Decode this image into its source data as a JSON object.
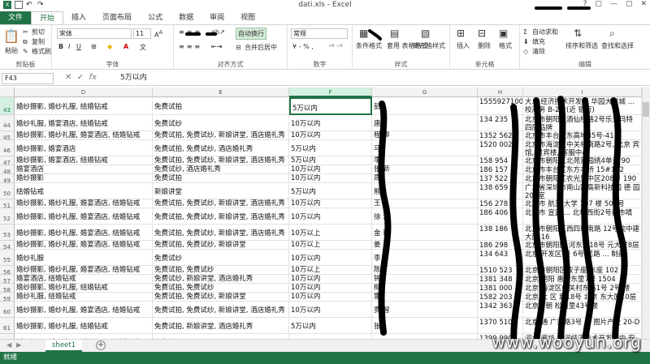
{
  "window": {
    "title": "dati.xls - Excel",
    "buttons": [
      "?",
      "▢",
      "—",
      "▢",
      "✕"
    ]
  },
  "tabs": [
    "文件",
    "开始",
    "插入",
    "页面布局",
    "公式",
    "数据",
    "审阅",
    "视图"
  ],
  "ribbon": {
    "clipboard": {
      "paste": "粘贴",
      "cut": "剪切",
      "copy": "复制",
      "format_painter": "格式刷",
      "label": "剪贴板"
    },
    "font": {
      "name": "宋体",
      "size": "11",
      "label": "字体"
    },
    "alignment": {
      "wrap": "自动换行",
      "merge": "合并后居中",
      "label": "对齐方式"
    },
    "number": {
      "format": "常规",
      "label": "数字"
    },
    "styles": {
      "conditional": "条件格式",
      "table": "套用\n表格格式",
      "cell": "单元格样式",
      "label": "样式"
    },
    "cells": {
      "insert": "插入",
      "delete": "删除",
      "format": "格式",
      "label": "单元格"
    },
    "editing": {
      "autosum": "自动求和",
      "fill": "填充",
      "clear": "清除",
      "sort": "排序和筛选",
      "find": "查找和选择",
      "label": "编辑"
    }
  },
  "formula_bar": {
    "name_box": "F43",
    "fx": "fx",
    "content": "5万以内"
  },
  "columns": [
    "D",
    "E",
    "F",
    "G",
    "H",
    "I"
  ],
  "rows": [
    {
      "num": "43",
      "D": "婚纱摄影, 婚纱礼服, 结婚钻戒",
      "E": "免费试拍",
      "F": "5万以内",
      "G": "彭",
      "H": "15559271001",
      "I": "大... 经济技术开发区 华园大雄城 ... 校商务 B-2号(近 银行)"
    },
    {
      "num": "44",
      "D": "婚纱礼服, 婚宴酒店, 结婚钻戒",
      "E": "免费试纱",
      "F": "10万以内",
      "G": "唐",
      "H": "134 235",
      "I": "北京市朝阳区酒仙桥路2号乐天玛特 四层品牌"
    },
    {
      "num": "45",
      "D": "婚纱摄影, 婚纱礼服, 婚宴酒店, 结婚钻戒",
      "E": "免费试拍, 免费试纱, 新娘讲堂, 酒店婚礼秀",
      "F": "10万以内",
      "G": "程 烨",
      "H": "1352 562",
      "I": "北京市丰台区东高地35号-41"
    },
    {
      "num": "46",
      "D": "婚纱摄影, 婚宴酒店",
      "E": "免费试拍, 免费试纱, 酒店婚礼秀",
      "F": "5万以内",
      "G": "马",
      "H": "1520 002",
      "I": "北京市海淀区中关村南路2号, 北京 宾馆, 贵宾楼, 客服中心"
    },
    {
      "num": "47",
      "D": "婚纱摄影, 婚宴酒店, 结婚钻戒",
      "E": "免费试拍, 免费试纱, 新娘讲堂, 酒店婚礼秀",
      "F": "5万以内",
      "G": "李",
      "H": "158 954",
      "I": "北京市朝阳区北苑家园绣4单元 90"
    },
    {
      "num": "48",
      "D": "婚宴酒店",
      "E": "免费试纱, 酒店婚礼秀",
      "F": "10万以内",
      "G": "张 新",
      "H": "186 157",
      "I": "北京市丰台区东方丰桥 15#102"
    },
    {
      "num": "49",
      "D": "婚纱摄影",
      "E": "免费试拍",
      "F": "10万以内",
      "G": "周",
      "H": "137 522",
      "I": "北京市朝阳区农光里中区208号 190"
    },
    {
      "num": "50",
      "D": "结婚钻戒",
      "E": "新娘讲堂",
      "F": "5万以内",
      "G": "熊",
      "H": "138 659",
      "I": "广东省深圳市南山区高新科技园 德 园 203室"
    },
    {
      "num": "51",
      "D": "婚纱摄影, 婚纱礼服, 婚宴酒店, 结婚钻戒",
      "E": "免费试拍, 免费试纱, 新娘讲堂, 酒店婚礼秀",
      "F": "10万以内",
      "G": "王",
      "H": "156 278",
      "I": "北京市 航天 大学 107 楼 506号"
    },
    {
      "num": "52",
      "D": "婚纱摄影, 婚纱礼服, 婚宴酒店, 结婚钻戒",
      "E": "免费试拍, 免费试纱, 新娘讲堂, 酒店婚礼秀",
      "F": "10万以内",
      "G": "徐 潇",
      "H": "186 406",
      "I": "北京市 宣武 ... 北坊西街2号都市晴"
    },
    {
      "num": "53",
      "D": "婚纱摄影, 婚纱礼服, 婚宴酒店, 结婚钻戒",
      "E": "免费试拍, 免费试纱, 新娘讲堂, 酒店婚礼秀",
      "F": "10万以上",
      "G": "金 琪",
      "H": "138 186",
      "I": "北京市朝阳区西四环南路 12号院中建 大厦 16"
    },
    {
      "num": "54",
      "D": "婚纱摄影, 婚纱礼服, 婚宴酒店, 结婚钻戒",
      "E": "免费试拍, 免费试纱, 新娘讲堂",
      "F": "10万以上",
      "G": "姜",
      "H": "186 298",
      "I": "北京市朝阳区 河东里18号 元大厦8层"
    },
    {
      "num": "55",
      "D": "婚纱礼服",
      "E": "免费试纱",
      "F": "10万以内",
      "G": "李",
      "H": "134 643",
      "I": "北京 开发区 景 6号 民路 ... 制药"
    },
    {
      "num": "56",
      "D": "婚纱摄影, 婚纱礼服, 婚宴酒店, 结婚钻戒",
      "E": "免费试拍, 免费试纱",
      "F": "10万以上",
      "G": "陈",
      "H": "1510 523",
      "I": "北京市朝阳区双子座 东座 102"
    },
    {
      "num": "57",
      "D": "婚宴酒店, 结婚钻戒",
      "E": "免费试纱, 新娘讲堂, 酒店婚礼秀",
      "F": "10万以内",
      "G": "钟",
      "H": "1381 348",
      "I": "北京 朝阳 惠新东里7号 1504"
    },
    {
      "num": "58",
      "D": "婚纱摄影, 婚纱礼服, 结婚钻戒",
      "E": "免费试拍, 免费试纱",
      "F": "10万以内",
      "G": "柳",
      "H": "1381 000",
      "I": "北京 海淀区中关村东路1号 2号 楼A12"
    },
    {
      "num": "59",
      "D": "婚纱礼服, 结婚钻戒",
      "E": "免费试拍, 免费试纱, 新娘讲堂",
      "F": "10万以内",
      "G": "雷",
      "H": "1582 203",
      "I": "北京 大 区 路18号 北京 东大厦10层"
    },
    {
      "num": "60",
      "D": "婚纱摄影, 婚纱礼服, 婚宴酒店, 结婚钻戒",
      "E": "免费试拍, 免费试纱, 新娘讲堂, 酒店婚礼秀",
      "F": "10万以内",
      "G": "贾 智",
      "H": "1342 363",
      "I": "北京市朝 松榆里43号楼"
    },
    {
      "num": "61",
      "D": "婚纱摄影, 婚纱礼服, 结婚钻戒",
      "E": "免费试拍, 新娘讲堂, 酒店婚礼秀",
      "F": "5万以内",
      "G": "张",
      "H": "1370 510",
      "I": "北京 通 广渠路3号 兑 图片产业 20-D"
    },
    {
      "num": "62",
      "D": "婚纱摄影, 婚纱礼服, 婚宴酒店, 结婚钻戒",
      "E": "免费试纱",
      "F": "10万以内",
      "G": "",
      "H": "1399 990",
      "I": "河北 廊坊 香河经济技术开发区中 安 第一城 会议 有限公司 安吉"
    }
  ],
  "sheet_tab": "sheet1",
  "status": "就绪",
  "watermark": "www.wooyun.org"
}
